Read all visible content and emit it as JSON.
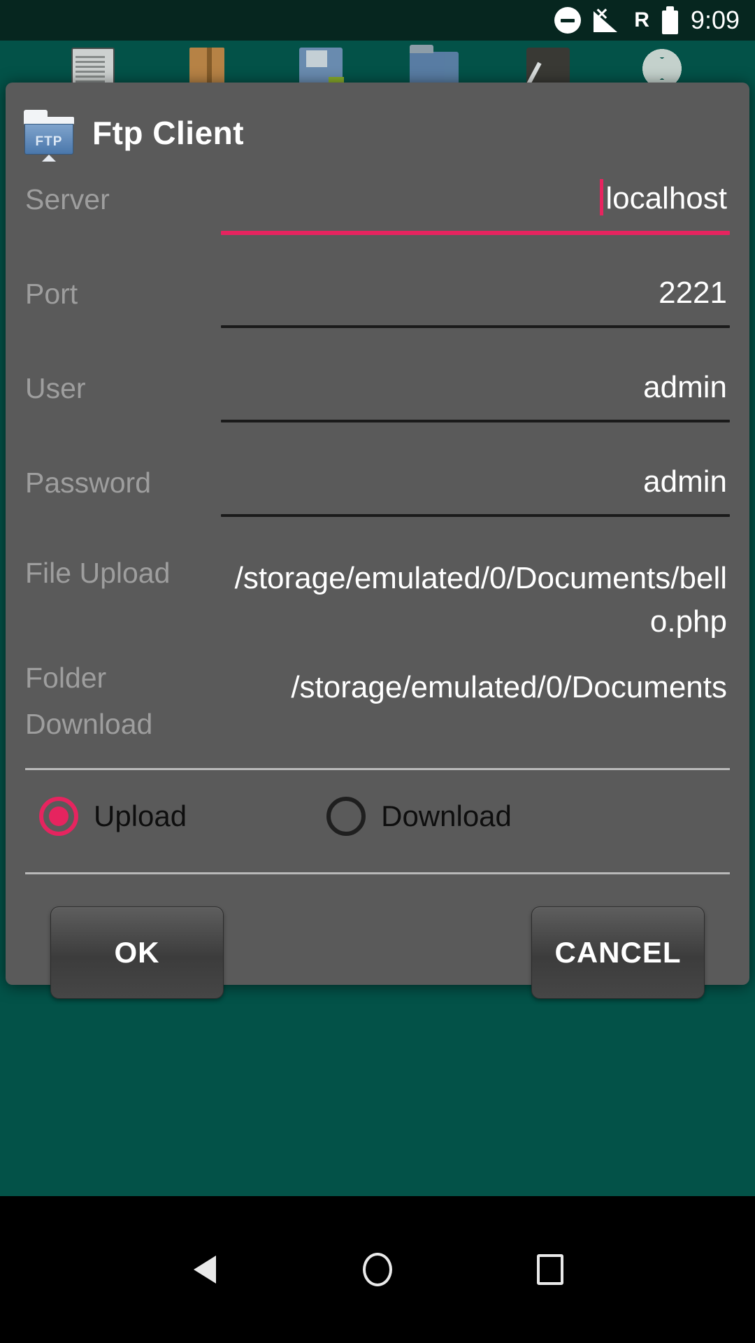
{
  "status_bar": {
    "dnd_icon": "do-not-disturb-icon",
    "signal_icon": "no-signal-icon",
    "roaming_label": "R",
    "battery_icon": "battery-icon",
    "time": "9:09"
  },
  "background_app": {
    "toolbar_icons": [
      "document-icon",
      "book-icon",
      "floppy-disk-save-icon",
      "folder-icon",
      "pen-icon",
      "gear-settings-icon"
    ]
  },
  "dialog": {
    "app_icon_label": "FTP",
    "title": "Ftp Client",
    "fields": [
      {
        "label": "Server",
        "value": "localhost",
        "focused": true,
        "has_caret": true
      },
      {
        "label": "Port",
        "value": "2221",
        "focused": false,
        "has_caret": false
      },
      {
        "label": "User",
        "value": "admin",
        "focused": false,
        "has_caret": false
      },
      {
        "label": "Password",
        "value": "admin",
        "focused": false,
        "has_caret": false
      },
      {
        "label": "File Upload",
        "value": "/storage/emulated/0/Documents/bello.php",
        "focused": false,
        "has_caret": false
      },
      {
        "label": "Folder Download",
        "value": "/storage/emulated/0/Documents",
        "focused": false,
        "has_caret": false
      }
    ],
    "mode_options": [
      {
        "label": "Upload",
        "selected": true
      },
      {
        "label": "Download",
        "selected": false
      }
    ],
    "buttons": {
      "ok": "OK",
      "cancel": "CANCEL"
    },
    "colors": {
      "accent": "#e6245f",
      "dialog_bg": "#5a5a5a",
      "label": "#9e9e9e",
      "value": "#ffffff",
      "underline_inactive": "#1a1a1a",
      "status_bar_bg": "#06261f",
      "app_bg": "#035248"
    }
  },
  "nav_bar": {
    "items": [
      "back-button",
      "home-button",
      "recents-button"
    ]
  }
}
